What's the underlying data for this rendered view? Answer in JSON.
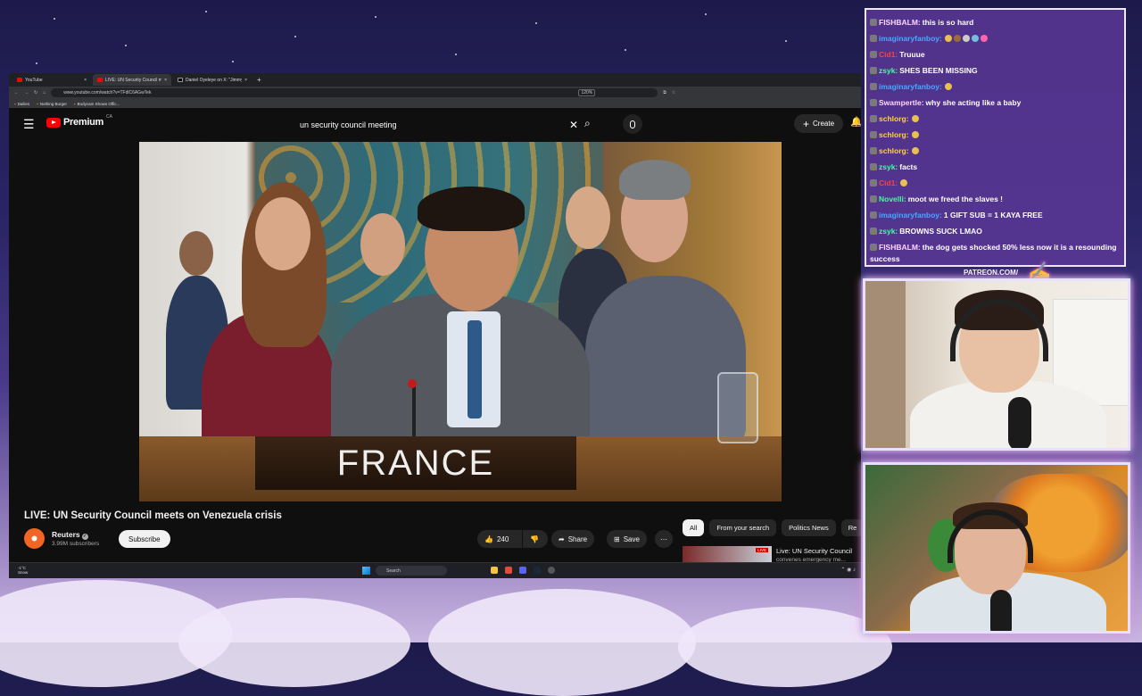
{
  "browser": {
    "tabs": [
      {
        "label": "YouTube",
        "active": false
      },
      {
        "label": "LIVE: UN Security Council m",
        "active": true
      },
      {
        "label": "Daniel Oyeleye on X: \"Jimmy Hi",
        "active": false
      }
    ],
    "new_tab": "+",
    "url": "www.youtube.com/watch?v=TFdlC6AGwTek",
    "zoom": "120%",
    "bookmarks": [
      "Dailies",
      "Nothing Burger",
      "Bodycam Shows Offic..."
    ]
  },
  "youtube": {
    "logo": "Premium",
    "region": "CA",
    "search_query": "un security council meeting",
    "create_label": "Create",
    "video": {
      "nameplate": "FRANCE",
      "title": "LIVE: UN Security Council meets on Venezuela crisis"
    },
    "channel": {
      "name": "Reuters",
      "subscribers": "3.99M subscribers",
      "subscribe_label": "Subscribe"
    },
    "actions": {
      "likes": "240",
      "share": "Share",
      "save": "Save",
      "more": "⋯"
    },
    "chips": [
      "All",
      "From your search",
      "Politics News",
      "Re"
    ],
    "recommended": {
      "badge": "LIVE",
      "title": "Live: UN Security Council",
      "subtitle": "convenes emergency me..."
    }
  },
  "taskbar": {
    "weather": "-1°C",
    "weather_desc": "Snow",
    "search": "Search"
  },
  "chat": [
    {
      "user": "FISHBALM:",
      "text": "this is so hard",
      "color": "#ffd6ff"
    },
    {
      "user": "imaginaryfanboy:",
      "text": "",
      "color": "#4aa8ff",
      "emotes": 5
    },
    {
      "user": "Cid1:",
      "text": "Truuue",
      "color": "#ff4040"
    },
    {
      "user": "zsyk:",
      "text": "SHES BEEN MISSING",
      "color": "#42ff9a"
    },
    {
      "user": "imaginaryfanboy:",
      "text": "",
      "color": "#4aa8ff",
      "emotes": 1
    },
    {
      "user": "Swampertle:",
      "text": "why she acting like a baby",
      "color": "#ffd6ff"
    },
    {
      "user": "schlorg:",
      "text": "",
      "color": "#ffd23f",
      "emotes": 1
    },
    {
      "user": "schlorg:",
      "text": "",
      "color": "#ffd23f",
      "emotes": 1
    },
    {
      "user": "schlorg:",
      "text": "",
      "color": "#ffd23f",
      "emotes": 1
    },
    {
      "user": "zsyk:",
      "text": "facts",
      "color": "#42ff9a"
    },
    {
      "user": "Cid1:",
      "text": "",
      "color": "#ff4040",
      "emotes": 1
    },
    {
      "user": "Novelli:",
      "text": "moot we freed the slaves !",
      "color": "#42ff9a"
    },
    {
      "user": "imaginaryfanboy:",
      "text": "1 GIFT SUB = 1 KAYA FREE",
      "color": "#4aa8ff"
    },
    {
      "user": "zsyk:",
      "text": "BROWNS SUCK LMAO",
      "color": "#42ff9a"
    },
    {
      "user": "FISHBALM:",
      "text": "the dog gets shocked 50% less now it is a resounding success",
      "color": "#ffd6ff"
    }
  ],
  "overlay": {
    "patreon": "PATREON.COM/",
    "signature": "Anything"
  }
}
